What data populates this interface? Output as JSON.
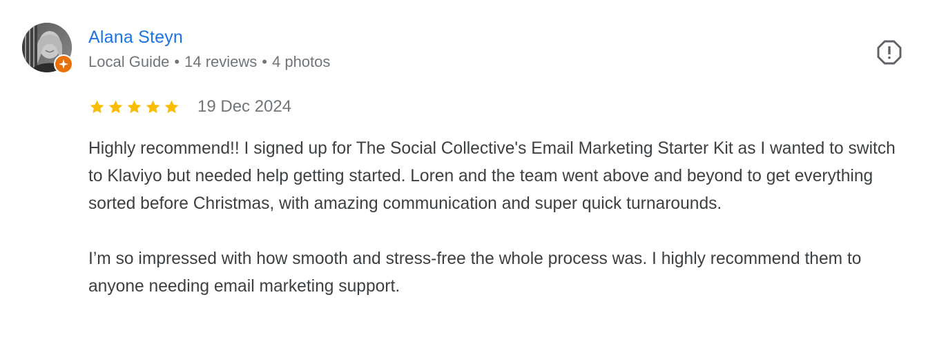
{
  "reviewer": {
    "name": "Alana Steyn",
    "level": "Local Guide",
    "reviews": "14 reviews",
    "photos": "4 photos",
    "separator": "•"
  },
  "review": {
    "rating": 5,
    "max_rating": 5,
    "date": "19 Dec 2024",
    "paragraphs": [
      "Highly recommend!! I signed up for The Social Collective's Email Marketing Starter Kit as I wanted to switch to Klaviyo but needed help getting started. Loren and the team went above and beyond to get everything sorted before Christmas, with amazing communication and super quick turnarounds.",
      "I’m so impressed with how smooth and stress-free the whole process was. I highly recommend them to anyone needing email marketing support."
    ]
  },
  "icons": {
    "star": "star-icon",
    "report": "report-flag-icon",
    "badge": "local-guide-badge-icon"
  },
  "colors": {
    "name": "#1a73e8",
    "meta": "#70757a",
    "text": "#3c4043",
    "star": "#fbbc04",
    "badge": "#e8710a"
  }
}
